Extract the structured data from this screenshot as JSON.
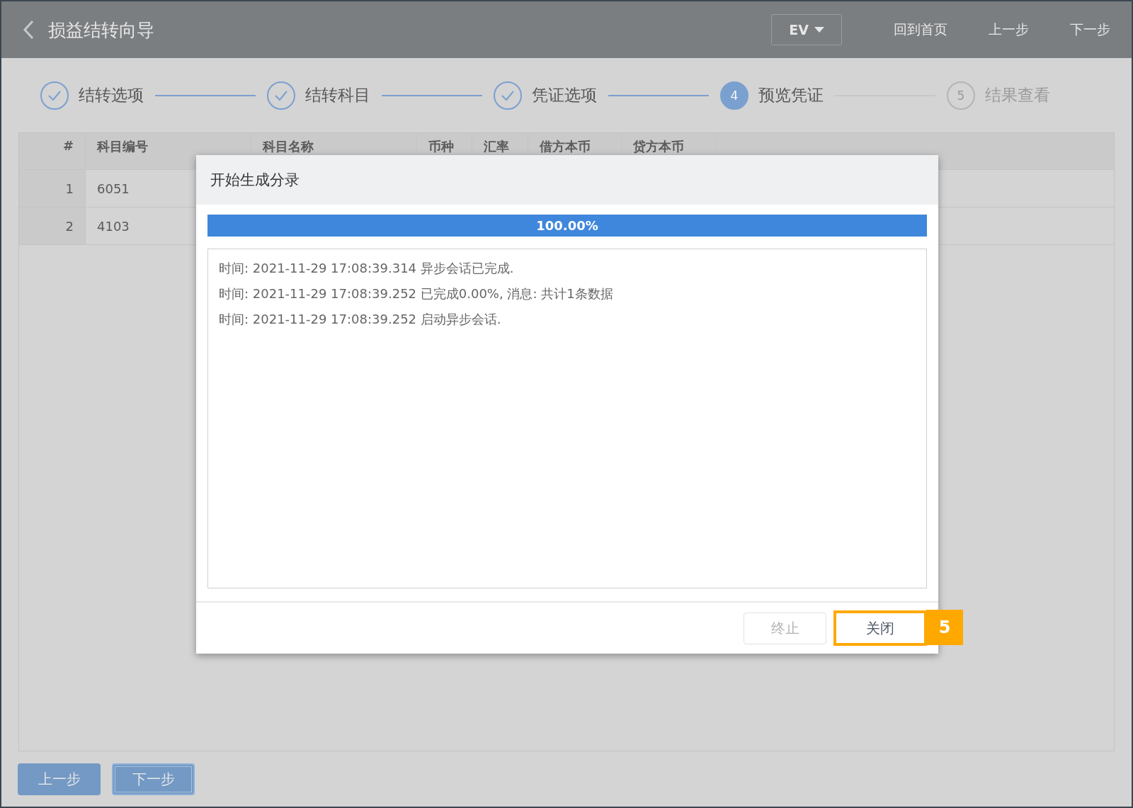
{
  "header": {
    "title": "损益结转向导",
    "dropdown": "EV",
    "links": [
      "回到首页",
      "上一步",
      "下一步"
    ]
  },
  "steps": [
    {
      "label": "结转选项",
      "kind": "done"
    },
    {
      "label": "结转科目",
      "kind": "done"
    },
    {
      "label": "凭证选项",
      "kind": "done"
    },
    {
      "label": "预览凭证",
      "number": "4",
      "kind": "active"
    },
    {
      "label": "结果查看",
      "number": "5",
      "kind": "pending"
    }
  ],
  "table": {
    "columns": [
      "#",
      "科目编号",
      "科目名称",
      "币种",
      "汇率",
      "借方本币",
      "贷方本币"
    ],
    "rows": [
      [
        "1",
        "6051"
      ],
      [
        "2",
        "4103"
      ]
    ]
  },
  "dialog": {
    "title": "开始生成分录",
    "progress": {
      "level": 1,
      "reading": "100.00%"
    },
    "log": [
      "时间: 2021-11-29 17:08:39.314 异步会话已完成.",
      "时间: 2021-11-29 17:08:39.252 已完成0.00%, 消息: 共计1条数据",
      "时间: 2021-11-29 17:08:39.252 启动异步会话."
    ],
    "buttons": [
      {
        "label": "终止",
        "disabled": true,
        "highlighted": false
      },
      {
        "label": "关闭",
        "disabled": false,
        "highlighted": true
      }
    ],
    "callout": "5"
  },
  "footer": {
    "buttons": [
      {
        "label": "上一步",
        "focused": false
      },
      {
        "label": "下一步",
        "focused": true
      }
    ]
  }
}
